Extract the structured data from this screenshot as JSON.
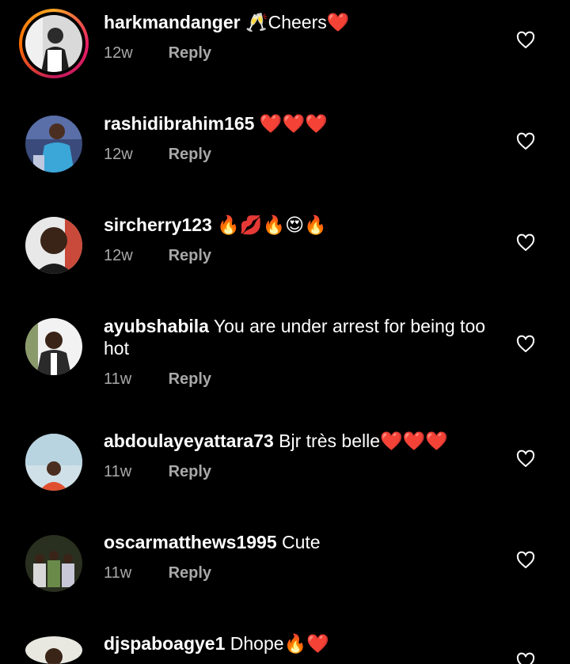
{
  "comments": [
    {
      "username": "harkmandanger",
      "text": "🥂Cheers❤️",
      "time": "12w",
      "reply_label": "Reply"
    },
    {
      "username": "rashidibrahim165",
      "text": "❤️❤️❤️",
      "time": "12w",
      "reply_label": "Reply"
    },
    {
      "username": "sircherry123",
      "text": "🔥💋🔥😍🔥",
      "time": "12w",
      "reply_label": "Reply"
    },
    {
      "username": "ayubshabila",
      "text": "You are under arrest for being too hot",
      "time": "11w",
      "reply_label": "Reply"
    },
    {
      "username": "abdoulayeyattara73",
      "text": "Bjr très belle❤️❤️❤️",
      "time": "11w",
      "reply_label": "Reply"
    },
    {
      "username": "oscarmatthews1995",
      "text": "Cute",
      "time": "11w",
      "reply_label": "Reply"
    },
    {
      "username": "djspaboagye1",
      "text": "Dhope🔥❤️",
      "time": "",
      "reply_label": ""
    }
  ],
  "colors": {
    "background": "#000000",
    "text": "#ffffff",
    "meta": "#a8a8a8",
    "story_ring": "#e91e63"
  },
  "icons": {
    "like": "heart-outline-icon"
  }
}
